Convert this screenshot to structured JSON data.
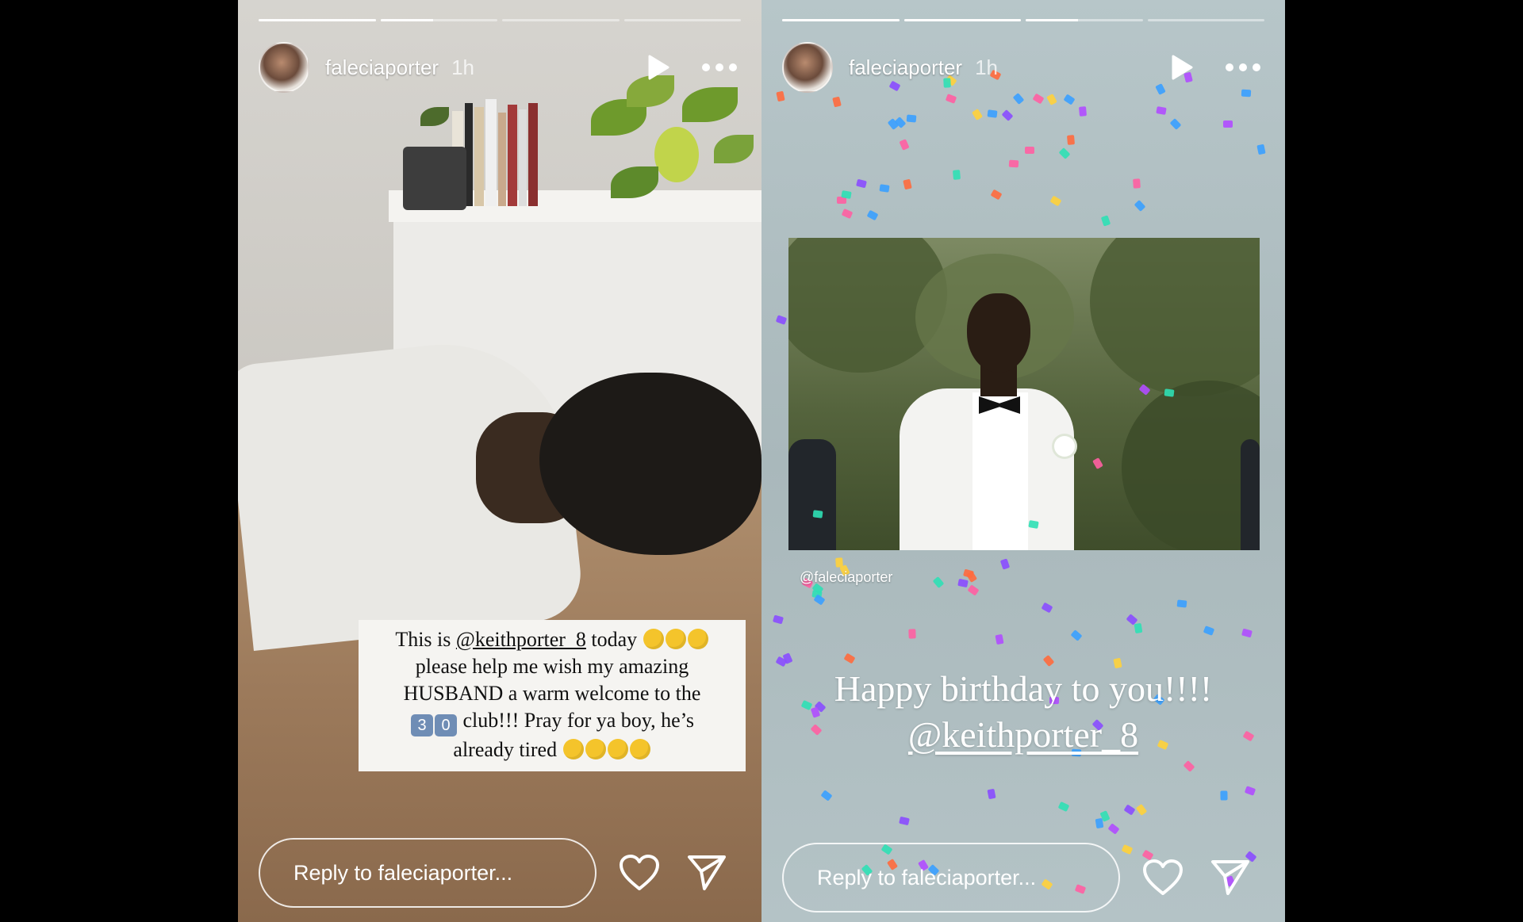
{
  "stories": [
    {
      "username": "faleciaporter",
      "time": "1h",
      "progress": [
        1.0,
        0.45,
        0.0,
        0.0
      ],
      "caption": {
        "line1_prefix": "This is ",
        "mention": "@keithporter_8",
        "line1_suffix": " today",
        "line2": "please help me wish my amazing",
        "line3": "HUSBAND a warm welcome to the",
        "keycap1": "3",
        "keycap2": "0",
        "line4_suffix": " club!!! Pray for ya boy, he’s",
        "line5": "already tired"
      },
      "reply_placeholder": "Reply to faleciaporter...",
      "icons": {
        "play": "play-icon",
        "more": "more-icon",
        "heart": "heart-icon",
        "send": "send-icon"
      }
    },
    {
      "username": "faleciaporter",
      "time": "1h",
      "progress": [
        1.0,
        1.0,
        0.45,
        0.0
      ],
      "photo_tag": "@faleciaporter",
      "birthday_line": "Happy birthday to you!!!!",
      "birthday_mention": "@keithporter_8",
      "reply_placeholder": "Reply to faleciaporter...",
      "icons": {
        "play": "play-icon",
        "more": "more-icon",
        "heart": "heart-icon",
        "send": "send-icon"
      }
    }
  ]
}
